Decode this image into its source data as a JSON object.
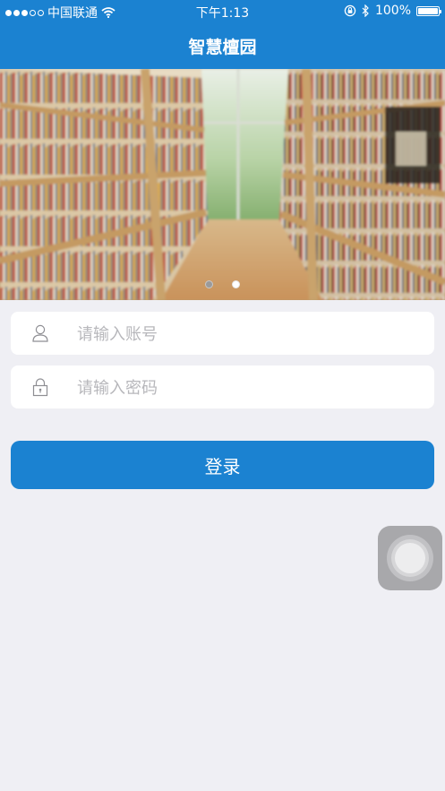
{
  "status_bar": {
    "carrier": "中国联通",
    "time": "下午1:13",
    "battery_percent": "100%",
    "battery_level": 1.0,
    "signal_bars_filled": 3,
    "signal_bars_total": 5,
    "icons": [
      "wifi-icon",
      "rotation-lock-icon",
      "bluetooth-icon",
      "battery-icon"
    ]
  },
  "nav": {
    "title": "智慧檀园"
  },
  "banner": {
    "pages_total": 2,
    "active_page": 2
  },
  "login_form": {
    "account_placeholder": "请输入账号",
    "account_icon": "user-icon",
    "password_placeholder": "请输入密码",
    "password_icon": "lock-icon",
    "login_label": "登录"
  },
  "colors": {
    "primary": "#1b82d1",
    "background": "#efeff4",
    "placeholder": "#b7b7bb"
  }
}
